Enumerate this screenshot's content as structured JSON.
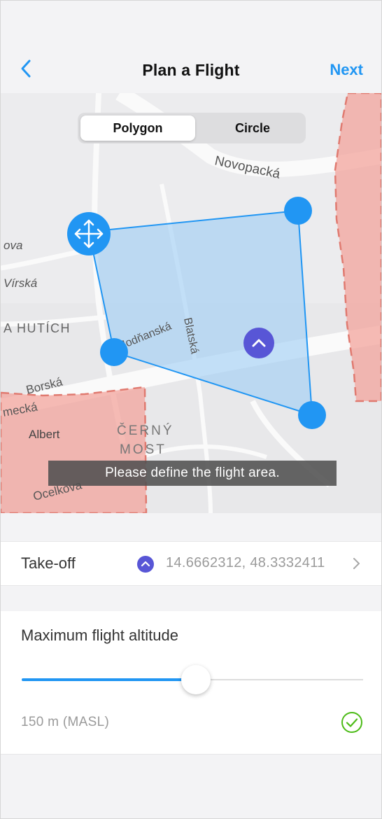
{
  "nav": {
    "back_icon": "chevron-left-icon",
    "title": "Plan a Flight",
    "next_label": "Next",
    "accent_color": "#2196f3"
  },
  "map": {
    "mode_tabs": [
      {
        "label": "Polygon",
        "selected": true
      },
      {
        "label": "Circle",
        "selected": false
      }
    ],
    "street_labels": {
      "novopacka": "Novopacká",
      "virska": "Vírská",
      "ova": "ova",
      "hutich": "A HUTÍCH",
      "bratska": "Blatská",
      "hodnanska": "Hodňanská",
      "borska": "Borská",
      "mecka": "mecká",
      "albert": "Albert",
      "cerny": "ČERNÝ",
      "most": "MOST",
      "ocelkova": "Ocelkova"
    },
    "hint": "Please define the flight area.",
    "restricted_zone_color": "#f3a49c",
    "area_fill_color": "#9ccdf5",
    "move_handle_icon": "move-arrows-icon",
    "takeoff_pin_icon": "chevron-up-icon",
    "takeoff_pin_color": "#5856d6"
  },
  "takeoff": {
    "label": "Take-off",
    "pin_icon": "chevron-up-icon",
    "coordinates": "14.6662312, 48.3332411",
    "chevron_icon": "chevron-right-icon"
  },
  "altitude": {
    "label": "Maximum flight altitude",
    "slider_fraction": 0.51,
    "value": "150 m (MASL)",
    "status_icon": "check-circle-icon",
    "status_color": "#4cbb17"
  }
}
